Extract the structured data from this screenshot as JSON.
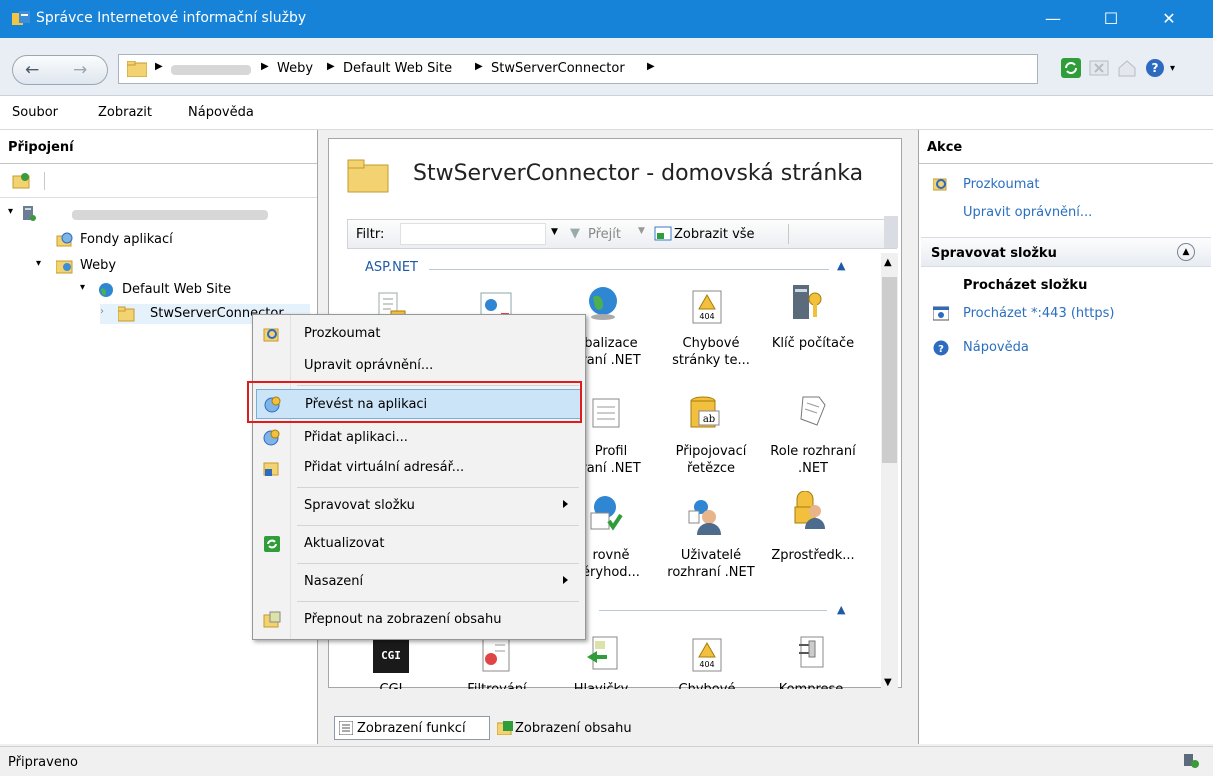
{
  "window": {
    "title": "Správce Internetové informační služby",
    "minimize_label": "—",
    "maximize_label": "☐",
    "close_label": "✕"
  },
  "address": {
    "breadcrumbs": [
      "Weby",
      "Default Web Site",
      "StwServerConnector"
    ]
  },
  "menu": [
    "Soubor",
    "Zobrazit",
    "Nápověda"
  ],
  "connections": {
    "header": "Připojení",
    "tree": {
      "app_pools": "Fondy aplikací",
      "sites": "Weby",
      "default_site": "Default Web Site",
      "selected": "StwServerConnector"
    }
  },
  "center": {
    "page_title": "StwServerConnector - domovská stránka",
    "filter_label": "Filtr:",
    "go_label": "Přejít",
    "show_all_label": "Zobrazit vše",
    "group_aspnet": "ASP.NET",
    "features_row1": [
      "balizace\nraní .NET",
      "Chybové\nstránky te...",
      "Klíč počítače"
    ],
    "features_row2": [
      "Profil\nraní .NET",
      "Připojovací\nřetězce",
      "Role rozhraní\n.NET"
    ],
    "features_row3": [
      "rovně\něryhod...",
      "Uživatelé\nrozhraní .NET",
      "Zprostředk..."
    ],
    "features_row4": [
      "CGI",
      "Filtrování",
      "Hlavičky",
      "Chybové",
      "Komprese"
    ],
    "cgi_icon_text": "CGI",
    "tab_features": "Zobrazení funkcí",
    "tab_content": "Zobrazení obsahu"
  },
  "actions": {
    "header": "Akce",
    "explore": "Prozkoumat",
    "edit_permissions": "Upravit oprávnění...",
    "manage_folder": "Spravovat složku",
    "browse_folder": "Procházet složku",
    "browse_https": "Procházet *:443 (https)",
    "help": "Nápověda"
  },
  "context_menu": {
    "explore": "Prozkoumat",
    "edit_permissions": "Upravit oprávnění...",
    "convert_to_app": "Převést na aplikaci",
    "add_app": "Přidat aplikaci...",
    "add_vdir": "Přidat virtuální adresář...",
    "manage_folder": "Spravovat složku",
    "refresh": "Aktualizovat",
    "deploy": "Nasazení",
    "switch_content": "Přepnout na zobrazení obsahu"
  },
  "status": {
    "text": "Připraveno"
  },
  "colors": {
    "titlebar": "#1683d8",
    "link": "#2a6fbf",
    "highlight": "#cce4f7",
    "callout": "#e01b1b"
  }
}
